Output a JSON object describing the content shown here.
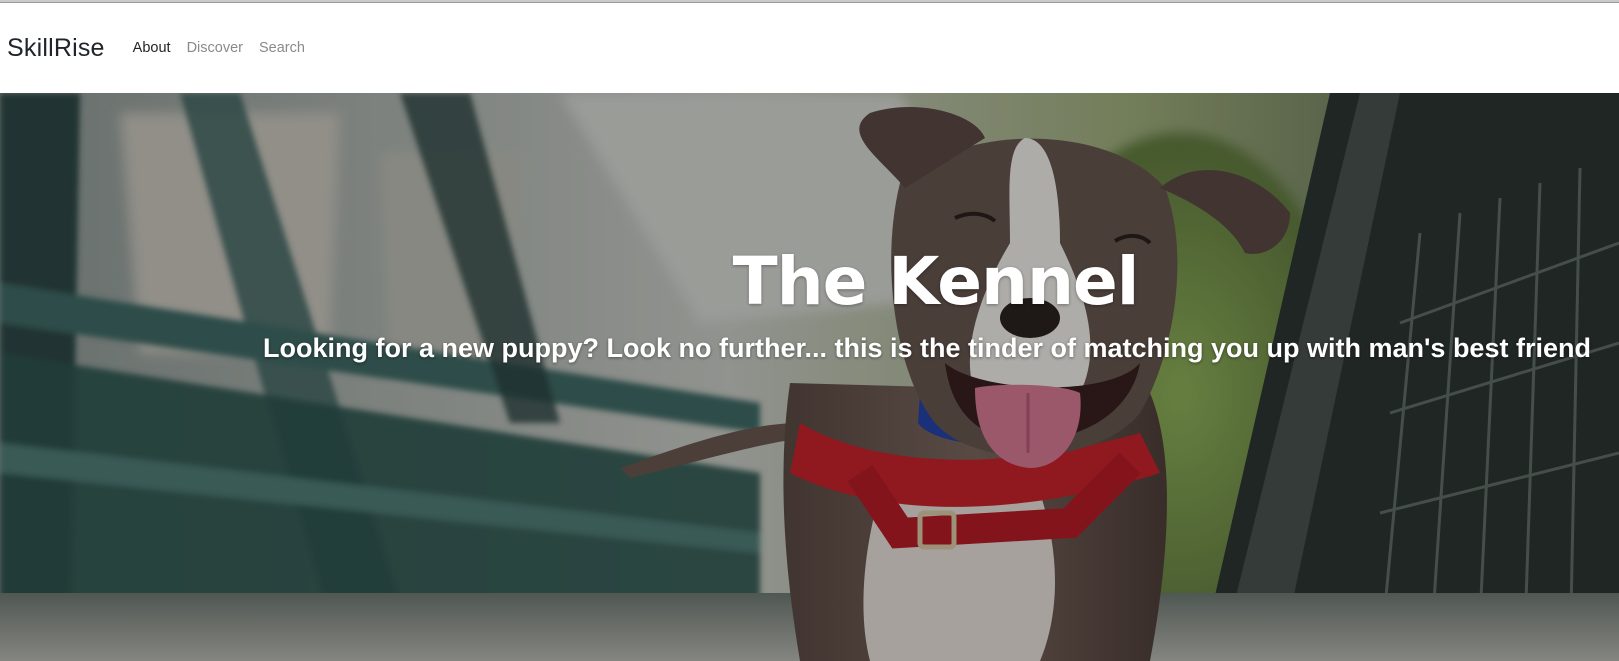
{
  "navbar": {
    "brand": "SkillRise",
    "links": [
      {
        "label": "About",
        "state": "active"
      },
      {
        "label": "Discover",
        "state": "default"
      },
      {
        "label": "Search",
        "state": "default"
      }
    ]
  },
  "hero": {
    "title": "The Kennel",
    "subtitle": "Looking for a new puppy? Look no further... this is the tinder of matching you up with man's best friend",
    "image": "photo-of-smiling-pit-bull-dog-with-red-harness-on-bridge"
  },
  "colors": {
    "nav_active": "#212529",
    "nav_muted": "#8a8a8a",
    "hero_text": "#ffffff",
    "harness_red": "#c8232c"
  }
}
